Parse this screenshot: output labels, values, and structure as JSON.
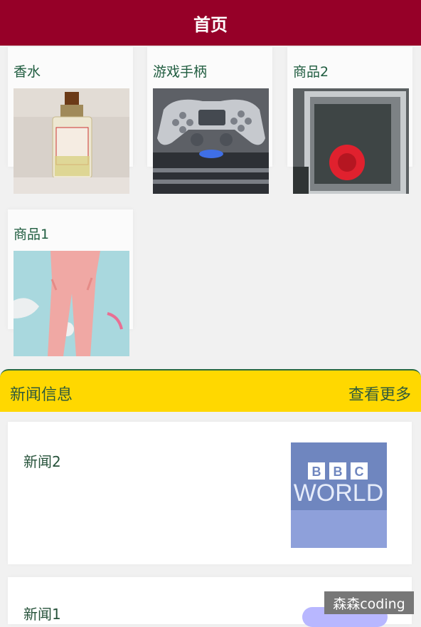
{
  "header": {
    "title": "首页"
  },
  "products": [
    {
      "name": "香水",
      "image": "perfume-image"
    },
    {
      "name": "游戏手柄",
      "image": "gamepad-image"
    },
    {
      "name": "商品2",
      "image": "product-2-image"
    },
    {
      "name": "商品1",
      "image": "pants-image"
    }
  ],
  "news_section": {
    "title": "新闻信息",
    "more_label": "查看更多",
    "accent": "#ffd800"
  },
  "news_items": [
    {
      "title": "新闻2",
      "thumb_text_top": "BBC",
      "thumb_text_bottom": "WORLD"
    },
    {
      "title": "新闻1"
    }
  ],
  "watermark": "森森coding",
  "colors": {
    "header_bg": "#960028",
    "text_green": "#26523a"
  }
}
